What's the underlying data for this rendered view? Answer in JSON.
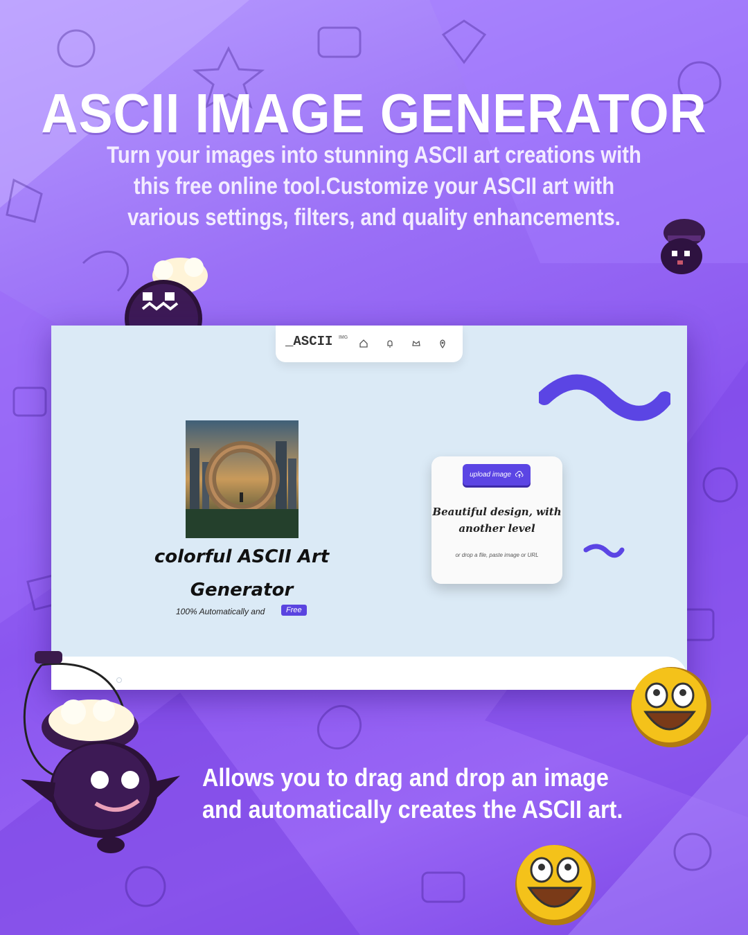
{
  "hero": {
    "title": "ASCII IMAGE GENERATOR",
    "subtitle": "Turn your images into stunning ASCII art creations with this free online tool.Customize your ASCII art with various settings, filters, and quality enhancements.",
    "footer": "Allows you to drag and drop an image and automatically creates the ASCII art."
  },
  "app": {
    "logo": "_ASCII",
    "logo_sup": "IMG",
    "nav_icons": [
      "home-icon",
      "bell-icon",
      "crown-icon",
      "location-pin-icon"
    ],
    "headline": "colorful ASCII Art Generator",
    "tagline": "100% Automatically and",
    "badge": "Free",
    "upload_label": "upload image",
    "card_heading": "Beautiful design, with another level",
    "card_note": "or drop a file, paste image or URL"
  },
  "colors": {
    "background": "#8b5cf0",
    "accent": "#5b45e4",
    "app_bg": "#dbeaf6"
  }
}
